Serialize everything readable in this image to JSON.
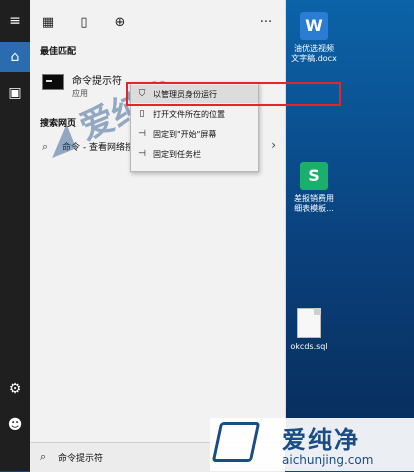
{
  "filters": [
    {
      "icon": "grid-icon"
    },
    {
      "icon": "document-icon"
    },
    {
      "icon": "globe-icon"
    },
    {
      "icon": "more-icon",
      "label": "···"
    }
  ],
  "sections": {
    "best_match": "最佳匹配",
    "search_web": "搜索网页"
  },
  "best_result": {
    "title": "命令提示符",
    "subtitle": "应用"
  },
  "web_result": {
    "text": "命令 - 查看网络搜"
  },
  "context_menu": [
    {
      "icon": "shield-icon",
      "label": "以管理员身份运行"
    },
    {
      "icon": "folder-icon",
      "label": "打开文件所在的位置"
    },
    {
      "icon": "pin-icon",
      "label": "固定到\"开始\"屏幕"
    },
    {
      "icon": "pin-icon",
      "label": "固定到任务栏"
    }
  ],
  "search_box": {
    "query": "命令提示符"
  },
  "desktop_icons": [
    {
      "label": "油优选视频",
      "label2": "文字稿.docx",
      "tile": "W",
      "color": "#2b7cd3"
    },
    {
      "label": "差报销费用",
      "label2": "细表模板...",
      "tile": "S",
      "color": "#1aaf6a"
    },
    {
      "label": "okcds.sql",
      "label2": ""
    }
  ],
  "watermark": {
    "cn": "爱纯净",
    "en": "aichunjing.com"
  },
  "colors": {
    "highlight": "#e2262d",
    "accent": "#2b6cb0"
  }
}
